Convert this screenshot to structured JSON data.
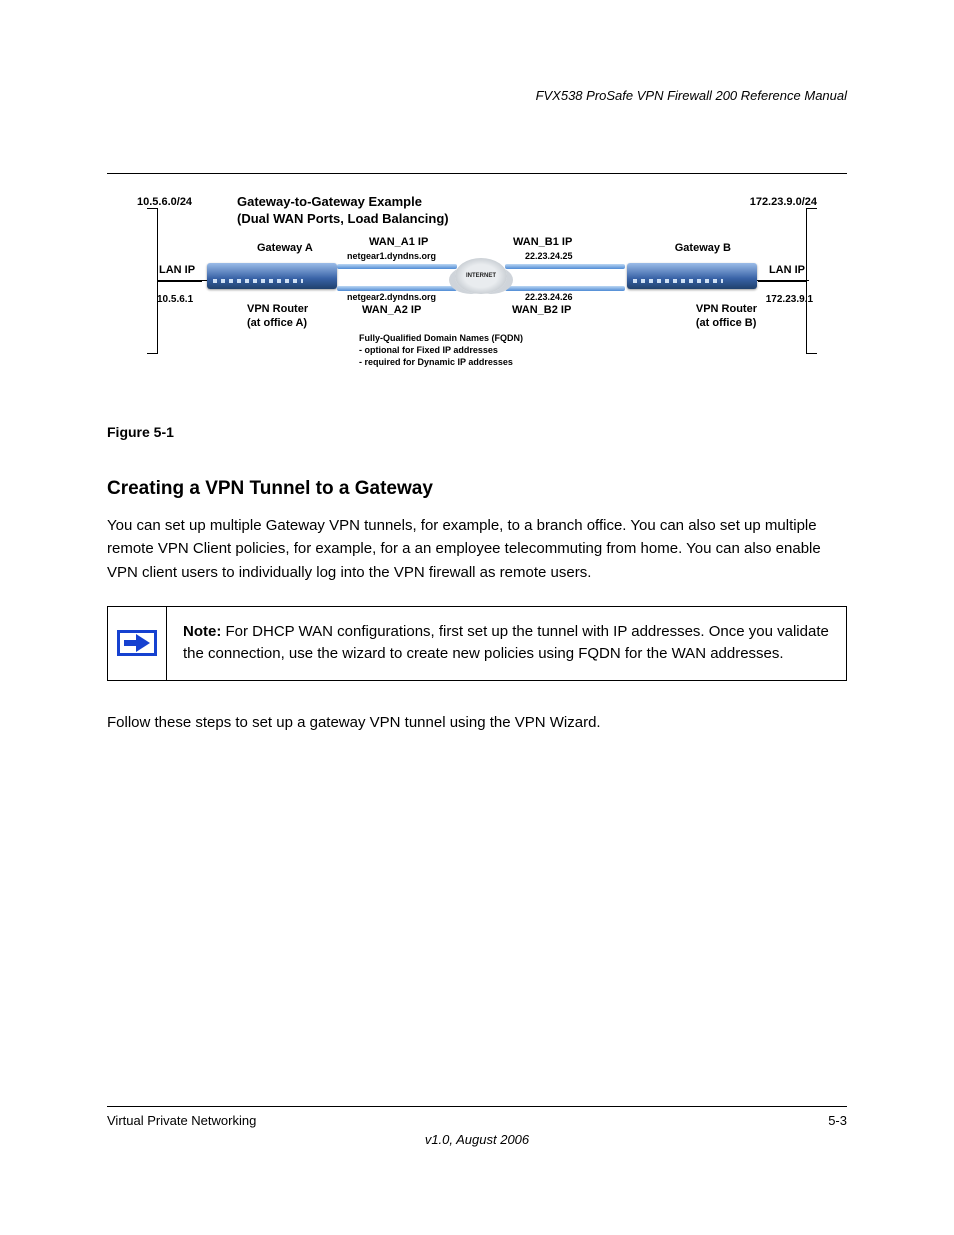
{
  "header": {
    "left": "",
    "right": "FVX538 ProSafe VPN Firewall 200 Reference Manual"
  },
  "diagram": {
    "title_l1": "Gateway-to-Gateway Example",
    "title_l2": "(Dual WAN Ports, Load Balancing)",
    "lan_a": {
      "net": "10.5.6.0/24",
      "label": "LAN IP",
      "ip": "10.5.6.1"
    },
    "lan_b": {
      "net": "172.23.9.0/24",
      "label": "LAN IP",
      "ip": "172.23.9.1"
    },
    "gw_a": "Gateway A",
    "gw_b": "Gateway B",
    "vpn_a_l1": "VPN Router",
    "vpn_a_l2": "(at office A)",
    "vpn_b_l1": "VPN Router",
    "vpn_b_l2": "(at office B)",
    "wan_a1": "WAN_A1 IP",
    "wan_a1_dns": "netgear1.dyndns.org",
    "wan_a2": "WAN_A2 IP",
    "wan_a2_dns": "netgear2.dyndns.org",
    "wan_b1": "WAN_B1 IP",
    "wan_b1_ip": "22.23.24.25",
    "wan_b2": "WAN_B2 IP",
    "wan_b2_ip": "22.23.24.26",
    "cloud": "INTERNET",
    "fqdn_l1": "Fully-Qualified Domain Names (FQDN)",
    "fqdn_l2": "- optional for Fixed IP addresses",
    "fqdn_l3": "- required for Dynamic IP addresses"
  },
  "figure_caption": "Figure 5-1",
  "section_title": "Creating a VPN Tunnel to a Gateway",
  "p1": "You can set up multiple Gateway VPN tunnels, for example, to a branch office. You can also set up multiple remote VPN Client policies, for example, for a an employee telecommuting from home. You can also enable VPN client users to individually log into the VPN firewall as remote users.",
  "note": {
    "label": "Note:",
    "text": " For DHCP WAN configurations, first set up the tunnel with IP addresses. Once you validate the connection, use the wizard to create new policies using FQDN for the WAN addresses."
  },
  "p2": "Follow these steps to set up a gateway VPN tunnel using the VPN Wizard.",
  "footer": {
    "left": "Virtual Private Networking",
    "right": "5-3",
    "version": "v1.0, August 2006"
  }
}
